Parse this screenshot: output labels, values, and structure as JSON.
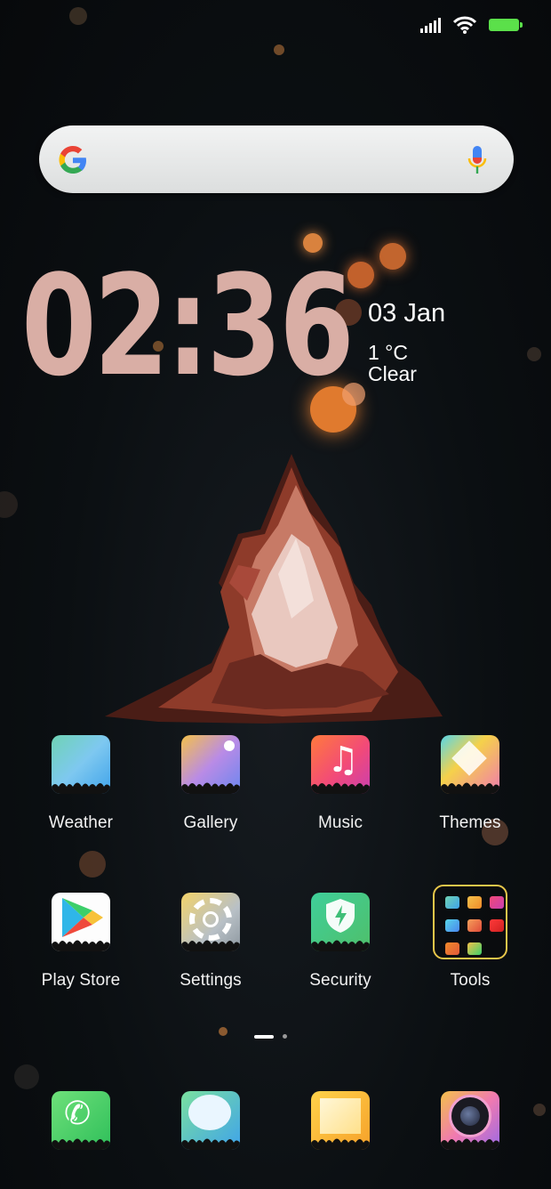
{
  "status": {
    "icons": [
      "signal-icon",
      "wifi-icon",
      "battery-icon"
    ],
    "battery_color": "#5be04a"
  },
  "search": {
    "icons": [
      "google-logo-icon",
      "microphone-icon"
    ]
  },
  "clock": {
    "time": "02:36",
    "color": "#d9aea5"
  },
  "weather_widget": {
    "date": "03 Jan",
    "temperature": "1 °C",
    "condition": "Clear"
  },
  "apps": [
    {
      "label": "Weather",
      "icon": "weather-icon"
    },
    {
      "label": "Gallery",
      "icon": "gallery-icon"
    },
    {
      "label": "Music",
      "icon": "music-icon"
    },
    {
      "label": "Themes",
      "icon": "themes-icon"
    },
    {
      "label": "Play Store",
      "icon": "play-store-icon"
    },
    {
      "label": "Settings",
      "icon": "settings-icon"
    },
    {
      "label": "Security",
      "icon": "security-icon"
    },
    {
      "label": "Tools",
      "icon": "folder-icon"
    }
  ],
  "page_indicator": {
    "pages": 2,
    "current": 1
  },
  "dock": [
    {
      "icon": "phone-icon"
    },
    {
      "icon": "messages-icon"
    },
    {
      "icon": "notes-icon"
    },
    {
      "icon": "camera-icon"
    }
  ],
  "accent_folder_border": "#e7c64a"
}
